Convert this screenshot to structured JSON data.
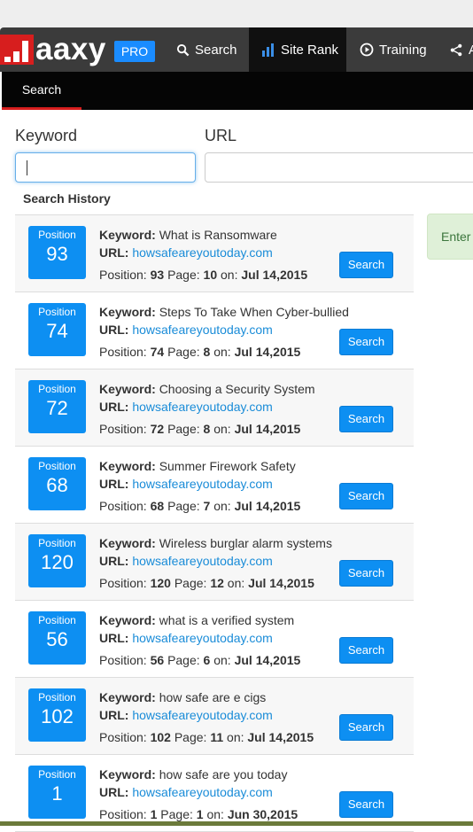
{
  "nav": {
    "logo_text": "aaxy",
    "pro_badge": "PRO",
    "items": [
      {
        "label": "Search",
        "icon": "search-icon"
      },
      {
        "label": "Site Rank",
        "icon": "bar-chart-icon"
      },
      {
        "label": "Training",
        "icon": "play-circle-icon"
      },
      {
        "label": "A",
        "icon": "share-icon"
      }
    ],
    "active_item": "Site Rank"
  },
  "subnav": {
    "items": [
      {
        "label": "Search"
      }
    ]
  },
  "form": {
    "keyword_label": "Keyword",
    "url_label": "URL",
    "keyword_value": "",
    "url_value": ""
  },
  "history": {
    "title": "Search History",
    "labels": {
      "position_badge": "Position",
      "keyword": "Keyword:",
      "url": "URL:",
      "position": "Position:",
      "page": "Page:",
      "on": "on:",
      "search_button": "Search"
    },
    "rows": [
      {
        "position": "93",
        "keyword": "What is Ransomware",
        "url": "howsafeareyoutoday.com",
        "page": "10",
        "date": "Jul 14,2015"
      },
      {
        "position": "74",
        "keyword": "Steps To Take When Cyber-bullied",
        "url": "howsafeareyoutoday.com",
        "page": "8",
        "date": "Jul 14,2015"
      },
      {
        "position": "72",
        "keyword": "Choosing a Security System",
        "url": "howsafeareyoutoday.com",
        "page": "8",
        "date": "Jul 14,2015"
      },
      {
        "position": "68",
        "keyword": "Summer Firework Safety",
        "url": "howsafeareyoutoday.com",
        "page": "7",
        "date": "Jul 14,2015"
      },
      {
        "position": "120",
        "keyword": "Wireless burglar alarm systems",
        "url": "howsafeareyoutoday.com",
        "page": "12",
        "date": "Jul 14,2015"
      },
      {
        "position": "56",
        "keyword": "what is a verified system",
        "url": "howsafeareyoutoday.com",
        "page": "6",
        "date": "Jul 14,2015"
      },
      {
        "position": "102",
        "keyword": "how safe are e cigs",
        "url": "howsafeareyoutoday.com",
        "page": "11",
        "date": "Jul 14,2015"
      },
      {
        "position": "1",
        "keyword": "how safe are you today",
        "url": "howsafeareyoutoday.com",
        "page": "1",
        "date": "Jun 30,2015"
      }
    ]
  },
  "alert": {
    "text": "Enter"
  },
  "colors": {
    "accent": "#0d8ff2",
    "brand_red": "#d71e1e",
    "navbar": "#3b3b3b",
    "link": "#1a8cd8"
  }
}
